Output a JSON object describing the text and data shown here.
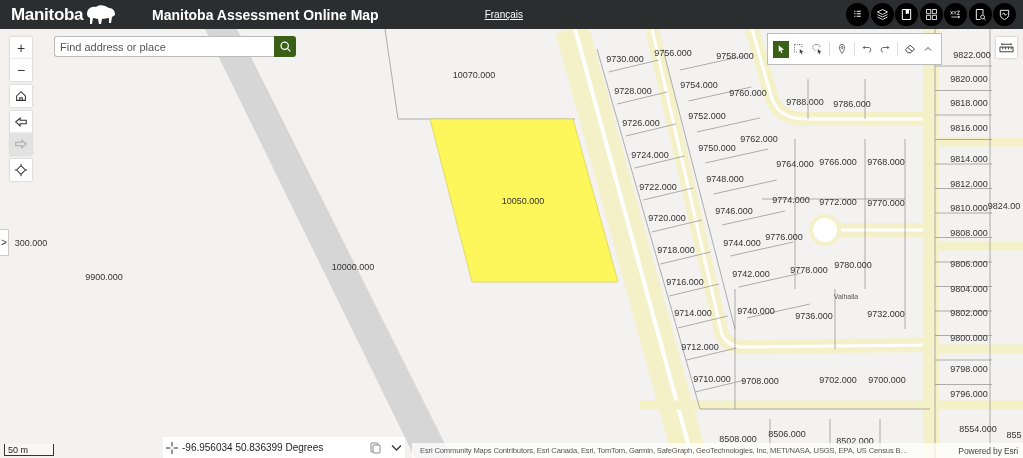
{
  "header": {
    "logo_text": "Manitoba",
    "title": "Manitoba Assessment Online Map",
    "language_link": "Français"
  },
  "search": {
    "placeholder": "Find address or place"
  },
  "nav_buttons": [
    {
      "kind": "zoom-in",
      "symbol": "+",
      "disabled": false
    },
    {
      "kind": "zoom-out",
      "symbol": "−",
      "disabled": false
    },
    {
      "kind": "home",
      "disabled": false
    },
    {
      "kind": "back",
      "disabled": false
    },
    {
      "kind": "forward",
      "disabled": true
    },
    {
      "kind": "locate",
      "disabled": false
    }
  ],
  "expand_button": {
    "symbol": ">"
  },
  "map_tools": [
    {
      "kind": "select",
      "selected": true
    },
    {
      "kind": "rectangle-select",
      "selected": false
    },
    {
      "kind": "lasso-select",
      "selected": false
    },
    {
      "kind": "pin",
      "selected": false
    },
    {
      "kind": "undo",
      "selected": false
    },
    {
      "kind": "redo",
      "selected": false
    },
    {
      "kind": "eraser",
      "selected": false
    },
    {
      "kind": "collapse",
      "selected": false
    }
  ],
  "parcels": [
    {
      "label": "10070.000",
      "selected": false
    },
    {
      "label": "10050.000",
      "selected": true
    },
    {
      "label": "10000.000",
      "selected": false
    },
    {
      "label": "9900.000",
      "selected": false
    },
    {
      "label": "300.000",
      "selected": false
    },
    {
      "label": "9730.000",
      "selected": false
    },
    {
      "label": "9728.000",
      "selected": false
    },
    {
      "label": "9726.000",
      "selected": false
    },
    {
      "label": "9724.000",
      "selected": false
    },
    {
      "label": "9722.000",
      "selected": false
    },
    {
      "label": "9720.000",
      "selected": false
    },
    {
      "label": "9718.000",
      "selected": false
    },
    {
      "label": "9716.000",
      "selected": false
    },
    {
      "label": "9714.000",
      "selected": false
    },
    {
      "label": "9712.000",
      "selected": false
    },
    {
      "label": "9710.000",
      "selected": false
    },
    {
      "label": "9708.000",
      "selected": false
    },
    {
      "label": "9756.000",
      "selected": false
    },
    {
      "label": "9758.000",
      "selected": false
    },
    {
      "label": "9754.000",
      "selected": false
    },
    {
      "label": "9760.000",
      "selected": false
    },
    {
      "label": "9752.000",
      "selected": false
    },
    {
      "label": "9762.000",
      "selected": false
    },
    {
      "label": "9750.000",
      "selected": false
    },
    {
      "label": "9748.000",
      "selected": false
    },
    {
      "label": "9746.000",
      "selected": false
    },
    {
      "label": "9744.000",
      "selected": false
    },
    {
      "label": "9742.000",
      "selected": false
    },
    {
      "label": "9740.000",
      "selected": false
    },
    {
      "label": "9788.000",
      "selected": false
    },
    {
      "label": "9786.000",
      "selected": false
    },
    {
      "label": "9764.000",
      "selected": false
    },
    {
      "label": "9766.000",
      "selected": false
    },
    {
      "label": "9768.000",
      "selected": false
    },
    {
      "label": "9774.000",
      "selected": false
    },
    {
      "label": "9772.000",
      "selected": false
    },
    {
      "label": "9770.000",
      "selected": false
    },
    {
      "label": "9776.000",
      "selected": false
    },
    {
      "label": "9778.000",
      "selected": false
    },
    {
      "label": "9780.000",
      "selected": false
    },
    {
      "label": "9736.000",
      "selected": false
    },
    {
      "label": "9732.000",
      "selected": false
    },
    {
      "label": "9822.000",
      "selected": false
    },
    {
      "label": "9820.000",
      "selected": false
    },
    {
      "label": "9818.000",
      "selected": false
    },
    {
      "label": "9816.000",
      "selected": false
    },
    {
      "label": "9814.000",
      "selected": false
    },
    {
      "label": "9812.000",
      "selected": false
    },
    {
      "label": "9810.000",
      "selected": false
    },
    {
      "label": "9824.00",
      "selected": false
    },
    {
      "label": "9808.000",
      "selected": false
    },
    {
      "label": "9806.000",
      "selected": false
    },
    {
      "label": "9804.000",
      "selected": false
    },
    {
      "label": "9802.000",
      "selected": false
    },
    {
      "label": "9800.000",
      "selected": false
    },
    {
      "label": "9798.000",
      "selected": false
    },
    {
      "label": "9796.000",
      "selected": false
    },
    {
      "label": "9702.000",
      "selected": false
    },
    {
      "label": "9700.000",
      "selected": false
    },
    {
      "label": "8554.000",
      "selected": false
    },
    {
      "label": "855",
      "selected": false
    },
    {
      "label": "8508.000",
      "selected": false
    },
    {
      "label": "8506.000",
      "selected": false
    },
    {
      "label": "8502.000",
      "selected": false
    }
  ],
  "street_labels": [
    "Valhalla"
  ],
  "scale_bar": "50 m",
  "coordinates": {
    "value": "-96.956034 50.836399 Degrees"
  },
  "attribution": "Esri Community Maps Contributors, Esri Canada, Esri, TomTom, Garmin, SafeGraph, GeoTechnologies, Inc, METI/NASA, USGS, EPA, US Census B…",
  "powered_by": "Powered by Esri"
}
